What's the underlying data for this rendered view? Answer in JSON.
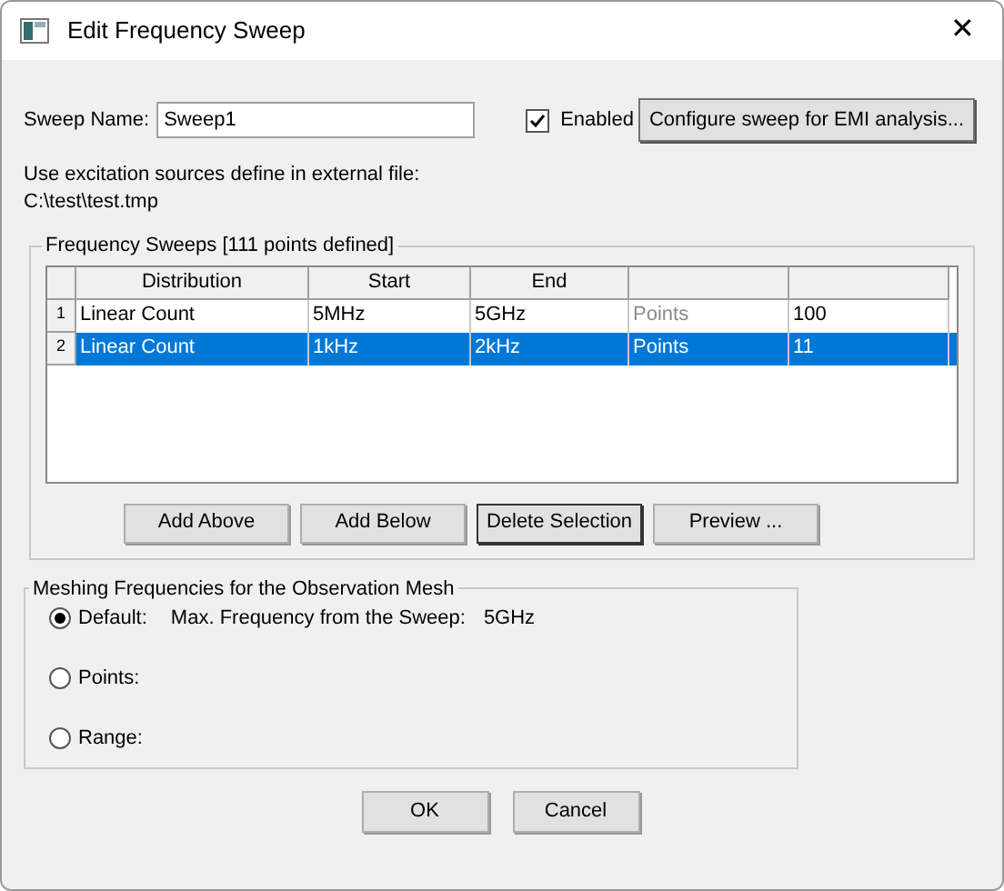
{
  "window": {
    "title": "Edit Frequency Sweep",
    "close": "✕"
  },
  "sweep_name": {
    "label": "Sweep Name:",
    "value": "Sweep1"
  },
  "enabled": {
    "label": "Enabled",
    "checked": true
  },
  "configure_button": "Configure sweep for EMI analysis...",
  "excitation_note": [
    "Use excitation sources define in external file:",
    "C:\\test\\test.tmp"
  ],
  "sweeps_group": {
    "title": "Frequency Sweeps [111 points defined]",
    "table": {
      "columns": [
        "Distribution",
        "Start",
        "End"
      ],
      "rows": [
        {
          "index": "1",
          "selected": false,
          "cells": [
            {
              "text": "Linear Count",
              "disabled": false
            },
            {
              "text": "5MHz",
              "disabled": false
            },
            {
              "text": "5GHz",
              "disabled": false
            },
            {
              "text": "Points",
              "disabled": true
            },
            {
              "text": "100",
              "disabled": false
            }
          ]
        },
        {
          "index": "2",
          "selected": true,
          "cells": [
            {
              "text": "Linear Count",
              "disabled": false
            },
            {
              "text": "1kHz",
              "disabled": false
            },
            {
              "text": "2kHz",
              "disabled": false
            },
            {
              "text": "Points",
              "disabled": false
            },
            {
              "text": "11",
              "disabled": false
            }
          ]
        }
      ]
    },
    "buttons": [
      {
        "label": "Add Above",
        "focused": false
      },
      {
        "label": "Add Below",
        "focused": false
      },
      {
        "label": "Delete Selection",
        "focused": true
      },
      {
        "label": "Preview ...",
        "focused": false
      }
    ]
  },
  "meshing_group": {
    "title": "Meshing Frequencies for the Observation Mesh",
    "options": [
      {
        "label": "Default:",
        "selected": true,
        "note": "Max. Frequency from the Sweep:",
        "value": "5GHz"
      },
      {
        "label": "Points:",
        "selected": false
      },
      {
        "label": "Range:",
        "selected": false
      }
    ]
  },
  "buttons": [
    "OK",
    "Cancel"
  ]
}
